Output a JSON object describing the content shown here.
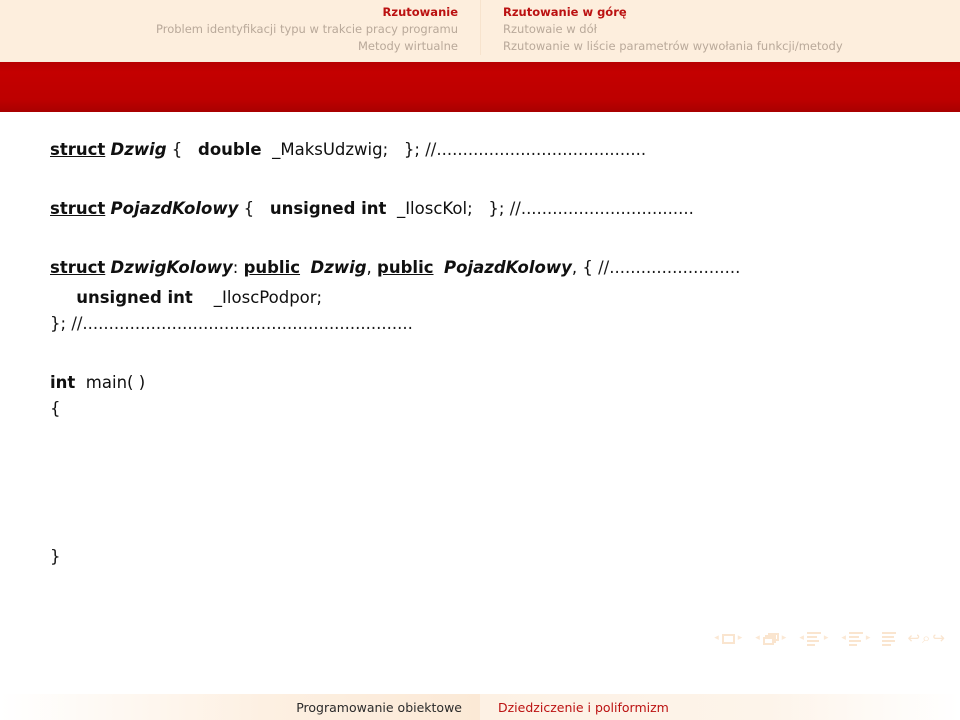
{
  "header": {
    "left_column": [
      {
        "label": "Rzutowanie",
        "state": "active"
      },
      {
        "label": "Problem identyfikacji typu w trakcie pracy programu",
        "state": "inactive"
      },
      {
        "label": "Metody wirtualne",
        "state": "inactive"
      }
    ],
    "right_column": [
      {
        "label": "Rzutowanie w górę",
        "state": "active"
      },
      {
        "label": "Rzutowaie w dół",
        "state": "inactive"
      },
      {
        "label": "Rzutowanie w liście parametrów wywołania funkcji/metody",
        "state": "inactive"
      }
    ]
  },
  "title_band": {
    "title": ""
  },
  "code": {
    "line1": {
      "kw": "struct",
      "type": "Dzwig",
      "open": "{",
      "member_type": "double",
      "member_name": "_MaksUdzwig;",
      "close": "};",
      "comment": "//........................................"
    },
    "line2": {
      "kw": "struct",
      "type": "PojazdKolowy",
      "open": "{",
      "member_type": "unsigned int",
      "member_name": "_IloscKol;",
      "close": "};",
      "comment": "//................................."
    },
    "line3": {
      "kw": "struct",
      "type": "DzwigKolowy",
      "colon": ":",
      "access1": "public",
      "base1": "Dzwig",
      "comma": ",",
      "access2": "public",
      "base2": "PojazdKolowy",
      "comma2": ",",
      "open": "{",
      "comment": "//........................."
    },
    "line4": {
      "member_type": "unsigned int",
      "member_name": "_IloscPodpor;"
    },
    "line5": {
      "close": "};",
      "comment": "//..............................................................."
    },
    "line6": {
      "return_type": "int",
      "name": "main( )"
    },
    "line7": {
      "brace": "{"
    },
    "line8": {
      "brace": "}"
    }
  },
  "nav_symbols": {
    "prev_arrow": "◂",
    "next_arrow": "▸",
    "slide_icon": "slide-icon",
    "frame_icon": "frame-icon",
    "subsection_icon": "subsection-icon",
    "section_icon": "section-icon",
    "doc_icon": "document-icon",
    "back_icon": "↩",
    "search_icon": "⌕",
    "forward_icon": "↪"
  },
  "footer": {
    "left": "Programowanie obiektowe",
    "right": "Dziedziczenie i poliformizm"
  },
  "colors": {
    "header_bg": "#fdeedd",
    "band_red": "#bd0000",
    "accent_red": "#bb1111",
    "inactive_gray": "#b9a99a",
    "body_bg": "#ffffff",
    "nav_symbol": "#fae5cf"
  }
}
